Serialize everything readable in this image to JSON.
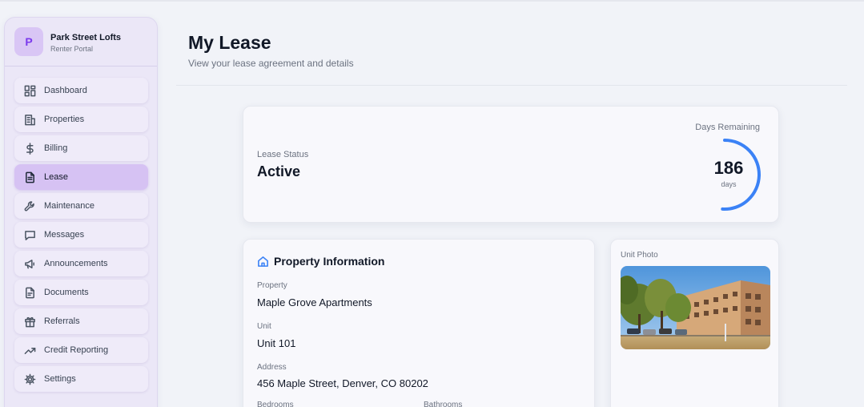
{
  "brand": {
    "initial": "P",
    "name": "Park Street Lofts",
    "subtitle": "Renter Portal"
  },
  "sidebar": {
    "items": [
      {
        "label": "Dashboard",
        "icon": "dashboard-icon",
        "active": false
      },
      {
        "label": "Properties",
        "icon": "building-icon",
        "active": false
      },
      {
        "label": "Billing",
        "icon": "dollar-icon",
        "active": false
      },
      {
        "label": "Lease",
        "icon": "document-icon",
        "active": true
      },
      {
        "label": "Maintenance",
        "icon": "wrench-icon",
        "active": false
      },
      {
        "label": "Messages",
        "icon": "message-icon",
        "active": false
      },
      {
        "label": "Announcements",
        "icon": "megaphone-icon",
        "active": false
      },
      {
        "label": "Documents",
        "icon": "file-icon",
        "active": false
      },
      {
        "label": "Referrals",
        "icon": "gift-icon",
        "active": false
      },
      {
        "label": "Credit Reporting",
        "icon": "trending-up-icon",
        "active": false
      },
      {
        "label": "Settings",
        "icon": "gear-icon",
        "active": false
      }
    ]
  },
  "header": {
    "title": "My Lease",
    "subtitle": "View your lease agreement and details"
  },
  "status": {
    "label": "Lease Status",
    "value": "Active",
    "days_label": "Days Remaining",
    "days_value": "186",
    "days_unit": "days",
    "ring_fraction": 0.51,
    "ring_color": "#3b82f6"
  },
  "property": {
    "title": "Property Information",
    "property_label": "Property",
    "property_value": "Maple Grove Apartments",
    "unit_label": "Unit",
    "unit_value": "Unit 101",
    "address_label": "Address",
    "address_value": "456 Maple Street, Denver, CO 80202",
    "bedrooms_label": "Bedrooms",
    "bathrooms_label": "Bathrooms"
  },
  "photo": {
    "label": "Unit Photo"
  },
  "colors": {
    "accent": "#3b82f6",
    "brand": "#7c3aed",
    "active_nav": "#d6c2f3"
  }
}
